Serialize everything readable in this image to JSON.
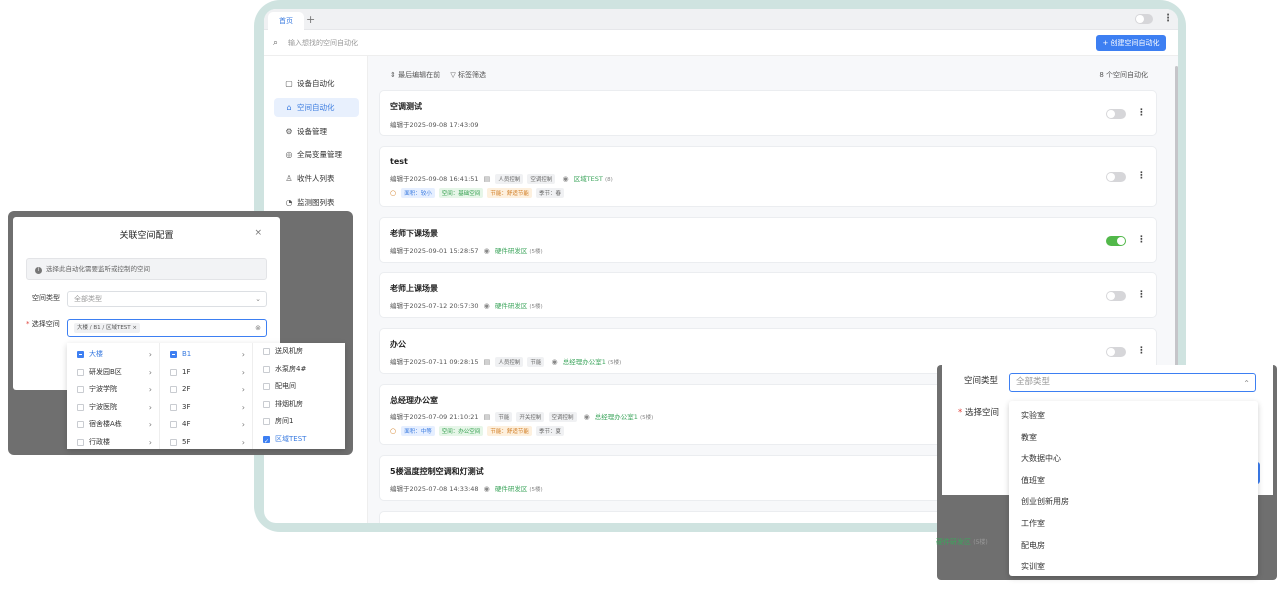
{
  "app": {
    "tabs": [
      {
        "label": "首页"
      }
    ],
    "tab_add": "+",
    "search_placeholder": "输入想找的空间自动化",
    "create_button": "+ 创建空间自动化",
    "sidebar": [
      {
        "label": "设备自动化",
        "icon": "device-automation-icon"
      },
      {
        "label": "空间自动化",
        "icon": "home-icon",
        "active": true
      },
      {
        "label": "设备管理",
        "icon": "gear-icon"
      },
      {
        "label": "全局变量管理",
        "icon": "globe-icon"
      },
      {
        "label": "收件人列表",
        "icon": "user-icon"
      },
      {
        "label": "监测图列表",
        "icon": "chart-icon"
      }
    ],
    "sort_label": "最后编辑在前",
    "filter_label": "标签筛选",
    "count_label": "8 个空间自动化",
    "cards": [
      {
        "title": "空调测试",
        "meta": "编辑于2025-09-08 17:43:09",
        "enabled": false
      },
      {
        "title": "test",
        "meta": "编辑于2025-09-08 16:41:51",
        "tags": [
          "人员控制",
          "空调控制"
        ],
        "location": "区域TEST",
        "location_count": "(8)",
        "extra_tags": [
          "面积：较小",
          "空间：基础空间",
          "节能：舒适节能",
          "季节：春"
        ],
        "enabled": false
      },
      {
        "title": "老师下课场景",
        "meta": "编辑于2025-09-01 15:28:57",
        "location": "硬件研发区",
        "location_count": "(5楼)",
        "enabled": true
      },
      {
        "title": "老师上课场景",
        "meta": "编辑于2025-07-12 20:57:30",
        "location": "硬件研发区",
        "location_count": "(5楼)",
        "enabled": false
      },
      {
        "title": "办公",
        "meta": "编辑于2025-07-11 09:28:15",
        "tags": [
          "人员控制",
          "节能"
        ],
        "location": "总经理办公室1",
        "location_count": "(5楼)",
        "enabled": false
      },
      {
        "title": "总经理办公室",
        "meta": "编辑于2025-07-09 21:10:21",
        "tags": [
          "节能",
          "开关控制",
          "空调控制"
        ],
        "location": "总经理办公室1",
        "location_count": "(5楼)",
        "extra_tags": [
          "面积：中等",
          "空间：办公空间",
          "节能：舒适节能",
          "季节：夏"
        ]
      },
      {
        "title": "5楼温度控制空调和灯测试",
        "meta": "编辑于2025-07-08 14:33:48",
        "location": "硬件研发区",
        "location_count": "(5楼)"
      }
    ]
  },
  "left_modal": {
    "title": "关联空间配置",
    "close": "×",
    "info": "选择此自动化需要监听或控制的空间",
    "space_type_label": "空间类型",
    "space_type_placeholder": "全部类型",
    "select_space_label": "选择空间",
    "required_mark": "*",
    "selected_chip": "大楼 / B1 / 区域TEST",
    "chip_close": "×",
    "col1": [
      "大楼",
      "研发园B区",
      "宁波学院",
      "宁波医院",
      "宿舍楼A栋",
      "行政楼"
    ],
    "col2": [
      "B1",
      "1F",
      "2F",
      "3F",
      "4F",
      "5F"
    ],
    "col3": [
      "送风机房",
      "水泵房4#",
      "配电间",
      "排烟机房",
      "房间1",
      "区域TEST"
    ]
  },
  "right_modal": {
    "space_type_label": "空间类型",
    "space_type_placeholder": "全部类型",
    "select_space_label": "选择空间",
    "required_mark": "*",
    "options": [
      "实验室",
      "教室",
      "大数据中心",
      "值班室",
      "创业创新用房",
      "工作室",
      "配电房",
      "实训室"
    ],
    "background_location": "硬件研发区",
    "background_location_count": "(5楼)"
  }
}
